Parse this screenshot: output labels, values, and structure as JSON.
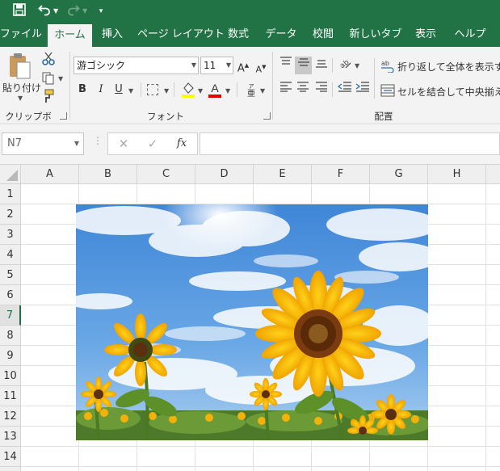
{
  "quick_access": {
    "save_icon": "save-icon",
    "undo_icon": "undo-icon",
    "redo_icon": "redo-icon",
    "customize_icon": "customize-qat-icon"
  },
  "tabs": [
    {
      "label": "ファイル",
      "active": false
    },
    {
      "label": "ホーム",
      "active": true
    },
    {
      "label": "挿入",
      "active": false
    },
    {
      "label": "ページ レイアウト",
      "active": false
    },
    {
      "label": "数式",
      "active": false
    },
    {
      "label": "データ",
      "active": false
    },
    {
      "label": "校閲",
      "active": false
    },
    {
      "label": "新しいタブ",
      "active": false
    },
    {
      "label": "表示",
      "active": false
    },
    {
      "label": "ヘルプ",
      "active": false
    }
  ],
  "ribbon": {
    "clipboard": {
      "paste_label": "貼り付け",
      "group_label": "クリップボード"
    },
    "font": {
      "font_name": "游ゴシック",
      "font_size": "11",
      "bold": "B",
      "italic": "I",
      "underline": "U",
      "grow": "A",
      "shrink": "A",
      "group_label": "フォント"
    },
    "alignment": {
      "wrap_text": "折り返して全体を表示する",
      "merge_center": "セルを結合して中央揃え",
      "group_label": "配置"
    }
  },
  "formula_bar": {
    "name_box": "N7",
    "cancel": "✕",
    "enter": "✓",
    "fx": "fx",
    "formula": ""
  },
  "grid": {
    "columns": [
      "A",
      "B",
      "C",
      "D",
      "E",
      "F",
      "G",
      "H"
    ],
    "rows": [
      "1",
      "2",
      "3",
      "4",
      "5",
      "6",
      "7",
      "8",
      "9",
      "10",
      "11",
      "12",
      "13",
      "14"
    ],
    "active_row": "7"
  },
  "colors": {
    "excel_green": "#217346",
    "ribbon_bg": "#f3f3f3"
  }
}
